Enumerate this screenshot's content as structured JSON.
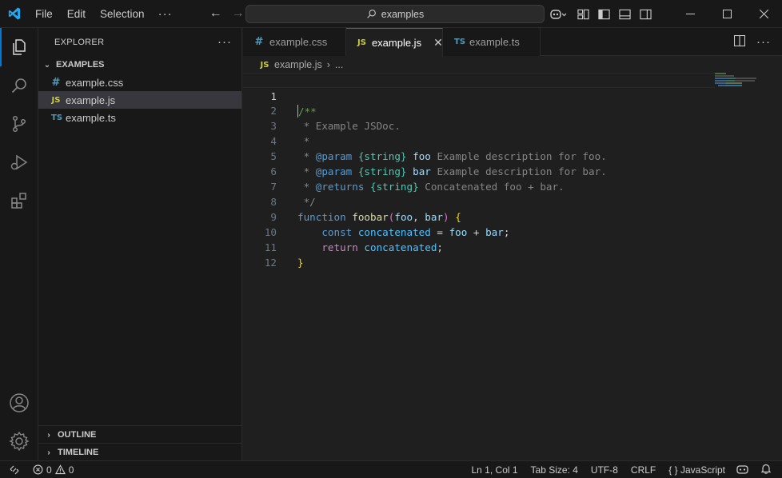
{
  "titlebar": {
    "menu": [
      "File",
      "Edit",
      "Selection"
    ],
    "more_label": "···",
    "search_text": "examples",
    "window_controls": [
      "minimize-icon",
      "maximize-icon",
      "close-icon"
    ]
  },
  "activity_bar": [
    "explorer-icon",
    "search-icon",
    "source-control-icon",
    "run-debug-icon",
    "extensions-icon",
    "account-icon",
    "manage-gear-icon"
  ],
  "sidebar": {
    "header": "EXPLORER",
    "more_label": "···",
    "folder": "EXAMPLES",
    "files": [
      {
        "icon": "#",
        "name": "example.css"
      },
      {
        "icon": "JS",
        "name": "example.js"
      },
      {
        "icon": "TS",
        "name": "example.ts"
      }
    ],
    "outline": "OUTLINE",
    "timeline": "TIMELINE"
  },
  "tabs": [
    {
      "icon": "#",
      "label": "example.css"
    },
    {
      "icon": "JS",
      "label": "example.js"
    },
    {
      "icon": "TS",
      "label": "example.ts"
    }
  ],
  "breadcrumb": {
    "icon": "JS",
    "file": "example.js",
    "sep": "›",
    "rest": "..."
  },
  "line_numbers": [
    "1",
    "2",
    "3",
    "4",
    "5",
    "6",
    "7",
    "8",
    "9",
    "10",
    "11",
    "12"
  ],
  "code": {
    "l1": "/**",
    "l2": " * Example JSDoc.",
    "l3": " *",
    "l4_star": " * ",
    "l4_tag": "@param",
    "l4_type": "{string}",
    "l4_name": "foo",
    "l4_desc": " Example description for foo.",
    "l5_star": " * ",
    "l5_tag": "@param",
    "l5_type": "{string}",
    "l5_name": "bar",
    "l5_desc": " Example description for bar.",
    "l6_star": " * ",
    "l6_tag": "@returns",
    "l6_type": "{string}",
    "l6_desc": " Concatenated foo + bar.",
    "l7": " */",
    "l8_kw": "function",
    "l8_fn": "foobar",
    "l8_open": "(",
    "l8_p1": "foo",
    "l8_comma": ", ",
    "l8_p2": "bar",
    "l8_close": ")",
    "l8_brace": " {",
    "l9_indent": "    ",
    "l9_kw": "const",
    "l9_var": " concatenated",
    "l9_eq": " = ",
    "l9_a": "foo",
    "l9_plus": " + ",
    "l9_b": "bar",
    "l9_semi": ";",
    "l10_indent": "    ",
    "l10_kw": "return",
    "l10_var": " concatenated",
    "l10_semi": ";",
    "l11": "}",
    "l12": ""
  },
  "statusbar": {
    "errors": "0",
    "warnings": "0",
    "position": "Ln 1, Col 1",
    "tab_size": "Tab Size: 4",
    "encoding": "UTF-8",
    "eol": "CRLF",
    "language_icon": "{ }",
    "language": "JavaScript"
  },
  "colors": {
    "accent": "#0078d4",
    "js": "#cbcb41",
    "ts": "#519aba",
    "css": "#519aba"
  }
}
